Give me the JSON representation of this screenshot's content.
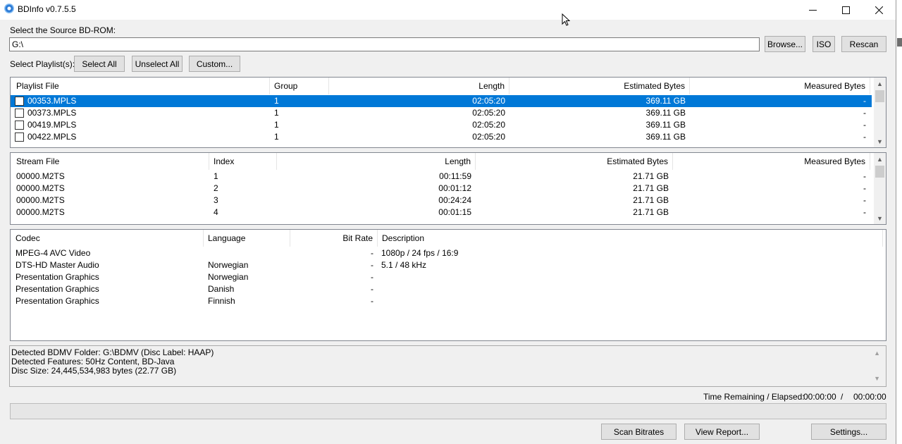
{
  "window": {
    "title": "BDInfo v0.7.5.5"
  },
  "source": {
    "label": "Select the Source BD-ROM:",
    "path": "G:\\",
    "browse_label": "Browse...",
    "iso_label": "ISO",
    "rescan_label": "Rescan"
  },
  "playlist_select": {
    "label": "Select Playlist(s):",
    "select_all_label": "Select All",
    "unselect_all_label": "Unselect All",
    "custom_label": "Custom..."
  },
  "playlists": {
    "columns": [
      "Playlist File",
      "Group",
      "Length",
      "Estimated Bytes",
      "Measured Bytes"
    ],
    "rows": [
      {
        "file": "00353.MPLS",
        "group": "1",
        "length": "02:05:20",
        "estimated": "369.11 GB",
        "measured": "-",
        "selected": true
      },
      {
        "file": "00373.MPLS",
        "group": "1",
        "length": "02:05:20",
        "estimated": "369.11 GB",
        "measured": "-"
      },
      {
        "file": "00419.MPLS",
        "group": "1",
        "length": "02:05:20",
        "estimated": "369.11 GB",
        "measured": "-"
      },
      {
        "file": "00422.MPLS",
        "group": "1",
        "length": "02:05:20",
        "estimated": "369.11 GB",
        "measured": "-"
      }
    ]
  },
  "streams": {
    "columns": [
      "Stream File",
      "Index",
      "Length",
      "Estimated Bytes",
      "Measured Bytes"
    ],
    "rows": [
      {
        "file": "00000.M2TS",
        "index": "1",
        "length": "00:11:59",
        "estimated": "21.71 GB",
        "measured": "-"
      },
      {
        "file": "00000.M2TS",
        "index": "2",
        "length": "00:01:12",
        "estimated": "21.71 GB",
        "measured": "-"
      },
      {
        "file": "00000.M2TS",
        "index": "3",
        "length": "00:24:24",
        "estimated": "21.71 GB",
        "measured": "-"
      },
      {
        "file": "00000.M2TS",
        "index": "4",
        "length": "00:01:15",
        "estimated": "21.71 GB",
        "measured": "-"
      }
    ]
  },
  "codecs": {
    "columns": [
      "Codec",
      "Language",
      "Bit Rate",
      "Description"
    ],
    "rows": [
      {
        "codec": "MPEG-4 AVC Video",
        "language": "",
        "bitrate": "-",
        "description": "1080p / 24 fps / 16:9"
      },
      {
        "codec": "DTS-HD Master Audio",
        "language": "Norwegian",
        "bitrate": "-",
        "description": "5.1 / 48 kHz"
      },
      {
        "codec": "Presentation Graphics",
        "language": "Norwegian",
        "bitrate": "-",
        "description": ""
      },
      {
        "codec": "Presentation Graphics",
        "language": "Danish",
        "bitrate": "-",
        "description": ""
      },
      {
        "codec": "Presentation Graphics",
        "language": "Finnish",
        "bitrate": "-",
        "description": ""
      }
    ]
  },
  "info": {
    "lines": [
      "Detected BDMV Folder: G:\\BDMV (Disc Label: HAAP)",
      "Detected Features: 50Hz Content, BD-Java",
      "Disc Size: 24,445,534,983 bytes (22.77 GB)"
    ]
  },
  "time": {
    "label": "Time Remaining / Elapsed:",
    "remaining": "00:00:00",
    "separator": "/",
    "elapsed": "00:00:00"
  },
  "progress": {
    "value": 0
  },
  "actions": {
    "scan_label": "Scan Bitrates",
    "report_label": "View Report...",
    "settings_label": "Settings..."
  },
  "icons": {
    "minimize": "minimize-icon",
    "maximize": "maximize-icon",
    "close": "close-icon"
  }
}
